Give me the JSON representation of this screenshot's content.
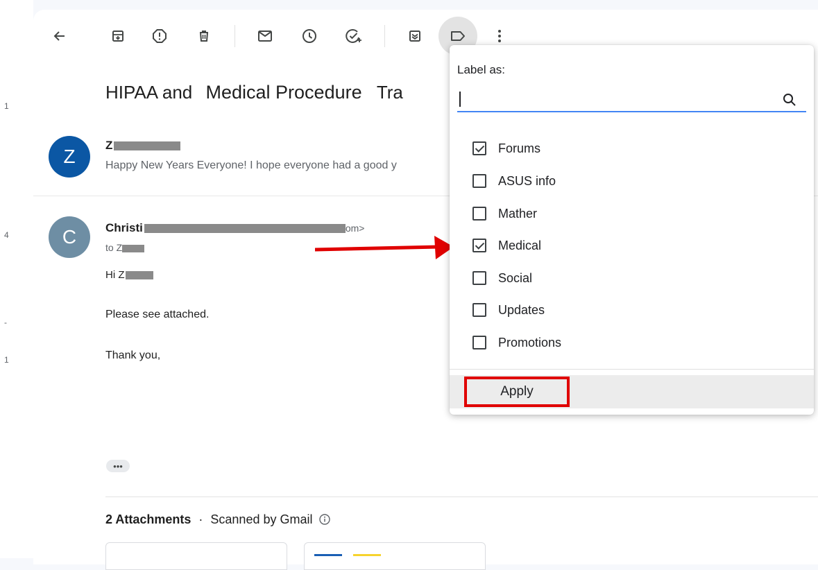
{
  "left_edge_marks": [
    "1",
    "4",
    "-",
    "1"
  ],
  "toolbar": {
    "back": "arrow-left-icon",
    "archive": "archive-icon",
    "report_spam": "report-icon",
    "delete": "trash-icon",
    "mark_unread": "mail-icon",
    "snooze": "clock-icon",
    "add_task": "add-task-icon",
    "move_to": "move-to-icon",
    "labels": "label-icon",
    "more": "more-vert-icon"
  },
  "subject": {
    "part1": "HIPAA and",
    "part2": "Medical Procedure",
    "part3": "Tra"
  },
  "messages": [
    {
      "avatar_letter": "Z",
      "avatar_color": "#0b57a4",
      "sender": "Z",
      "snippet": "Happy New Years Everyone! I hope everyone had a good y"
    },
    {
      "avatar_letter": "C",
      "avatar_color": "#6e8ea4",
      "sender": "Christi",
      "sender_tail": "om>",
      "to": "to Z",
      "greeting": "Hi Z",
      "body": "Please see attached.",
      "closing": "Thank you,"
    }
  ],
  "expand_dots": "•••",
  "attachments": {
    "count_label": "2 Attachments",
    "separator": "·",
    "scanned": "Scanned by Gmail"
  },
  "label_menu": {
    "title": "Label as:",
    "search_value": "",
    "labels": [
      {
        "name": "Forums",
        "checked": true
      },
      {
        "name": "ASUS info",
        "checked": false
      },
      {
        "name": "Mather",
        "checked": false
      },
      {
        "name": "Medical",
        "checked": true
      },
      {
        "name": "Social",
        "checked": false
      },
      {
        "name": "Updates",
        "checked": false
      },
      {
        "name": "Promotions",
        "checked": false
      }
    ],
    "apply_label": "Apply"
  },
  "colors": {
    "highlight": "#e00000",
    "accent": "#4285f4"
  }
}
